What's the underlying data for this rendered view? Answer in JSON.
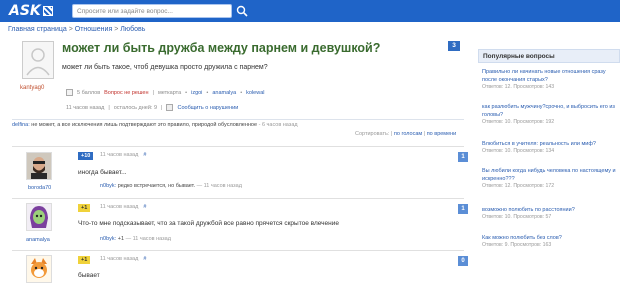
{
  "header": {
    "logo": "ASK",
    "search_placeholder": "Спросите или задайте вопрос..."
  },
  "breadcrumb": {
    "home": "Главная страница",
    "sep": ">",
    "cat": "Отношения",
    "sub": "Любовь"
  },
  "question": {
    "title": "может ли быть дружба между парнем и девушкой?",
    "text": "может ли быть такое, чтоб девушка просто дружила с парнем?",
    "author": "kantyag0",
    "answers_count": "3",
    "meta": {
      "points": "5 баллов",
      "status": "Вопрос не решен",
      "sep": "|",
      "tags_label": "меткарта",
      "tag1": "izgoi",
      "tag2": "anamalya",
      "tag3": "kolewal",
      "time": "11 часов назад",
      "period": "осталось дней: 9",
      "report": "Сообщить о нарушении"
    }
  },
  "comment": {
    "author": "delfina:",
    "text": "не может, а все исключения лишь подтверждают это правило, природой обусловленное",
    "time": "- 6 часов назад"
  },
  "sort": {
    "label": "Сортировать:",
    "by_votes": "по голосам",
    "sep": "|",
    "by_time": "по времени"
  },
  "answers": [
    {
      "author": "boroda70",
      "vote": "+10",
      "time": "11 часов назад",
      "hash": "#",
      "text": "иногда бывает...",
      "reply_author": "n0byk:",
      "reply_text": "редко встречается, но бывает.",
      "reply_time": "— 11 часов назад",
      "num": "1"
    },
    {
      "author": "anamalya",
      "vote": "+1",
      "time": "11 часов назад",
      "hash": "#",
      "text": "Что-то мне подсказывает, что за такой дружбой все равно прячется скрытое влечение",
      "reply_author": "n0byk:",
      "reply_text": "+1",
      "reply_time": "— 11 часов назад",
      "num": "1"
    },
    {
      "author": "",
      "vote": "+1",
      "time": "11 часов назад",
      "hash": "#",
      "text": "бывает",
      "reply_author": "",
      "reply_text": "",
      "reply_time": "",
      "num": "0"
    }
  ],
  "sidebar": {
    "title": "Популярные вопросы",
    "items": [
      {
        "q": "Правильно ли начинать новые отношения сразу после окончания старых?",
        "stats": "Ответов: 12. Просмотров: 143"
      },
      {
        "q": "как разлюбить мужчину?срочно, и выбросить его из головы?",
        "stats": "Ответов: 10. Просмотров: 192"
      },
      {
        "q": "Влюбиться в учителя: реальность или миф?",
        "stats": "Ответов: 10. Просмотров: 134"
      },
      {
        "q": "Вы любили когда нибудь человека по настоящему и искренно???",
        "stats": "Ответов: 12. Просмотров: 172"
      },
      {
        "q": "возможно полюбить по расстоянии?",
        "stats": "Ответов: 10. Просмотров: 57"
      },
      {
        "q": "Как можно полюбить без слов?",
        "stats": "Ответов: 9. Просмотров: 163"
      }
    ]
  },
  "colors": {
    "topbar": "#1f64c8",
    "title_green": "#3a6b2f",
    "link_blue": "#2a5db0",
    "vote_blue": "#2f6cc2",
    "vote_yellow": "#f0d23a"
  }
}
